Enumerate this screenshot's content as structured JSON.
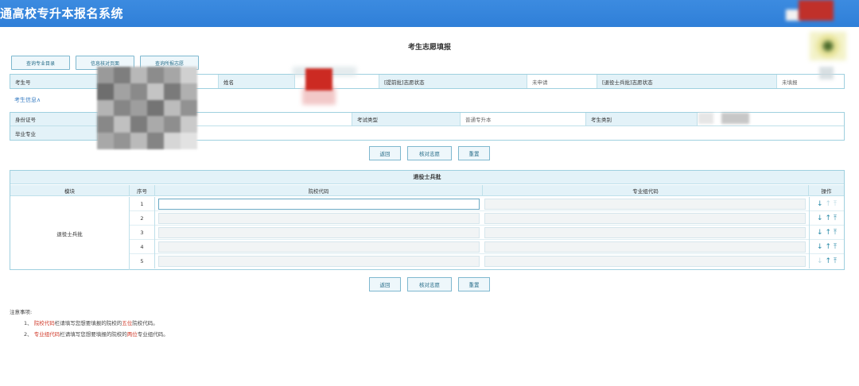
{
  "header": {
    "system_title": "通高校专升本报名系统"
  },
  "page": {
    "title": "考生志愿填报"
  },
  "toolbar": {
    "buttons": [
      "查询专业目录",
      "信息核对页面",
      "查询所报志愿"
    ]
  },
  "info": {
    "row1": {
      "exam_no_label": "考生号",
      "name_label": "姓名",
      "advance_status_label": "[提前批]志愿状态",
      "advance_status_value": "未申请",
      "veteran_status_label": "[退役士兵批]志愿状态",
      "veteran_status_value": "未填报"
    },
    "link": "考生信息∧",
    "row2": {
      "id_label": "身份证号",
      "exam_type_label": "考试类型",
      "exam_type_value": "普通专升本",
      "candidate_category_label": "考生类别"
    },
    "row3": {
      "major_label": "毕业专业"
    }
  },
  "actions": {
    "back": "返回",
    "check": "核对志愿",
    "reset": "重置"
  },
  "grid": {
    "title": "退役士兵批",
    "headers": {
      "module": "模块",
      "seq": "序号",
      "school_code": "院校代码",
      "major_group_code": "专业组代码",
      "ops": "操作"
    },
    "module_name": "退役士兵批",
    "rows": [
      {
        "seq": "1"
      },
      {
        "seq": "2"
      },
      {
        "seq": "3"
      },
      {
        "seq": "4"
      },
      {
        "seq": "5"
      }
    ],
    "icons": {
      "down": "↓",
      "up": "↑",
      "top": "⤒"
    }
  },
  "notes": {
    "title": "注意事项:",
    "items": [
      {
        "num": "1、",
        "key": "院校代码",
        "mid": "栏请填写您想要填报的院校的",
        "emph": "五位",
        "tail": "院校代码。"
      },
      {
        "num": "2、",
        "key": "专业组代码",
        "mid": "栏请填写您想要填报的院校的",
        "emph": "两位",
        "tail": "专业组代码。"
      }
    ]
  },
  "colors": {
    "header_blue": "#2f7fd8",
    "accent_teal": "#2a6f8a",
    "note_red": "#d03a2a",
    "label_bg": "#e3f2f8"
  }
}
